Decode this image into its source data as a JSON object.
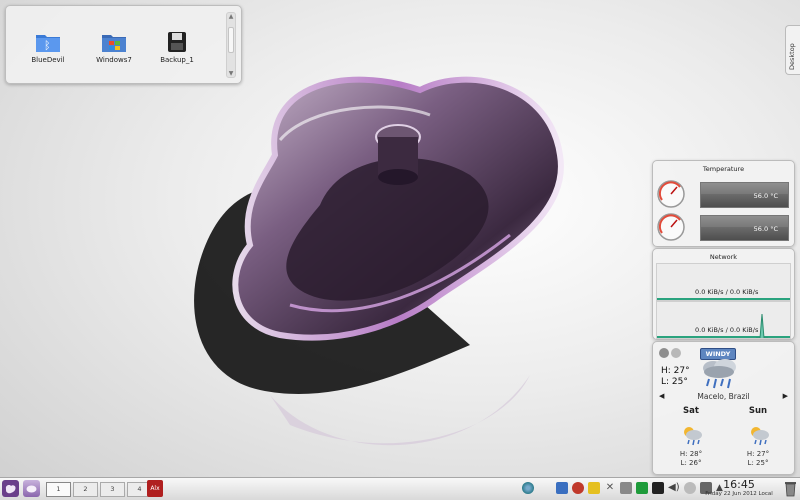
{
  "folder_view": {
    "icons": [
      {
        "name": "bluetooth-folder-icon",
        "label": "BlueDevil"
      },
      {
        "name": "windows-folder-icon",
        "label": "Windows7"
      },
      {
        "name": "drive-icon",
        "label": "Backup_1"
      }
    ]
  },
  "desktop_toolbox": {
    "label": "Desktop"
  },
  "temperature": {
    "title": "Temperature",
    "sensors": [
      {
        "value": "56.0 °C",
        "level": 0.56
      },
      {
        "value": "56.0 °C",
        "level": 0.56
      }
    ]
  },
  "network": {
    "title": "Network",
    "graphs": [
      {
        "value": "0.0 KiB/s / 0.0 KiB/s"
      },
      {
        "value": "0.0 KiB/s / 0.0 KiB/s"
      }
    ]
  },
  "weather": {
    "condition": "WINDY",
    "current_high": "H: 27°",
    "current_low": "L: 25°",
    "location": "Macelo, Brazil",
    "forecast": [
      {
        "day": "Sat",
        "high": "H: 28°",
        "low": "L: 26°"
      },
      {
        "day": "Sun",
        "high": "H: 27°",
        "low": "L: 25°"
      }
    ]
  },
  "panel": {
    "desktops": [
      "1",
      "2",
      "3",
      "4"
    ],
    "active_desktop": "1",
    "task_label": "Alx",
    "clock_time": "16:45",
    "clock_date": "Friday 22 Jun 2012 Local"
  },
  "colors": {
    "accent_purple": "#6a3f8a",
    "network_line": "#2aa37e",
    "tray_flag_green": "#1e9b3a"
  }
}
